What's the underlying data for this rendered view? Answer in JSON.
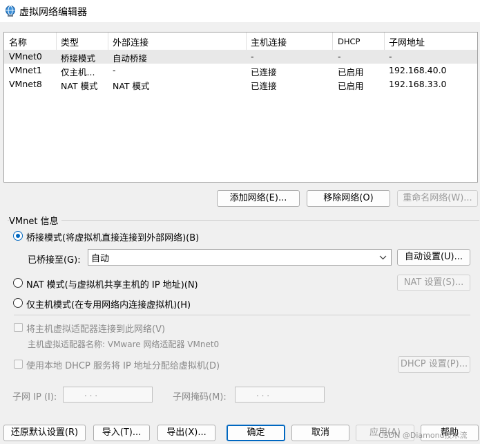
{
  "window": {
    "title": "虚拟网络编辑器"
  },
  "table": {
    "columns": [
      "名称",
      "类型",
      "外部连接",
      "主机连接",
      "DHCP",
      "子网地址"
    ],
    "rows": [
      [
        "VMnet0",
        "桥接模式",
        "自动桥接",
        "-",
        "-",
        "-"
      ],
      [
        "VMnet1",
        "仅主机...",
        "-",
        "已连接",
        "已启用",
        "192.168.40.0"
      ],
      [
        "VMnet8",
        "NAT 模式",
        "NAT 模式",
        "已连接",
        "已启用",
        "192.168.33.0"
      ]
    ]
  },
  "network_buttons": {
    "add": "添加网络(E)...",
    "remove": "移除网络(O)",
    "rename": "重命名网络(W)..."
  },
  "vmnet_info": {
    "title": "VMnet 信息",
    "bridge_mode": "桥接模式(将虚拟机直接连接到外部网络)(B)",
    "bridged_to_label": "已桥接至(G):",
    "bridged_to_value": "自动",
    "auto_settings": "自动设置(U)...",
    "nat_mode": "NAT 模式(与虚拟机共享主机的 IP 地址)(N)",
    "nat_settings": "NAT 设置(S)...",
    "host_only_mode": "仅主机模式(在专用网络内连接虚拟机)(H)",
    "connect_adapter": "将主机虚拟适配器连接到此网络(V)",
    "adapter_name": "主机虚拟适配器名称: VMware 网络适配器 VMnet0",
    "use_dhcp": "使用本地 DHCP 服务将 IP 地址分配给虚拟机(D)",
    "dhcp_settings": "DHCP 设置(P)...",
    "subnet_ip_label": "子网 IP (I):",
    "subnet_mask_label": "子网掩码(M):",
    "ip_placeholder": ".      .      ."
  },
  "footer": {
    "restore": "还原默认设置(R)",
    "import": "导入(T)...",
    "export": "导出(X)...",
    "ok": "确定",
    "cancel": "取消",
    "apply": "应用(A)",
    "help": "帮助",
    "watermark": "CSDN @Diamond技术流"
  },
  "colors": {
    "accent": "#0067c0",
    "selected_row": "#e8e8e8"
  }
}
